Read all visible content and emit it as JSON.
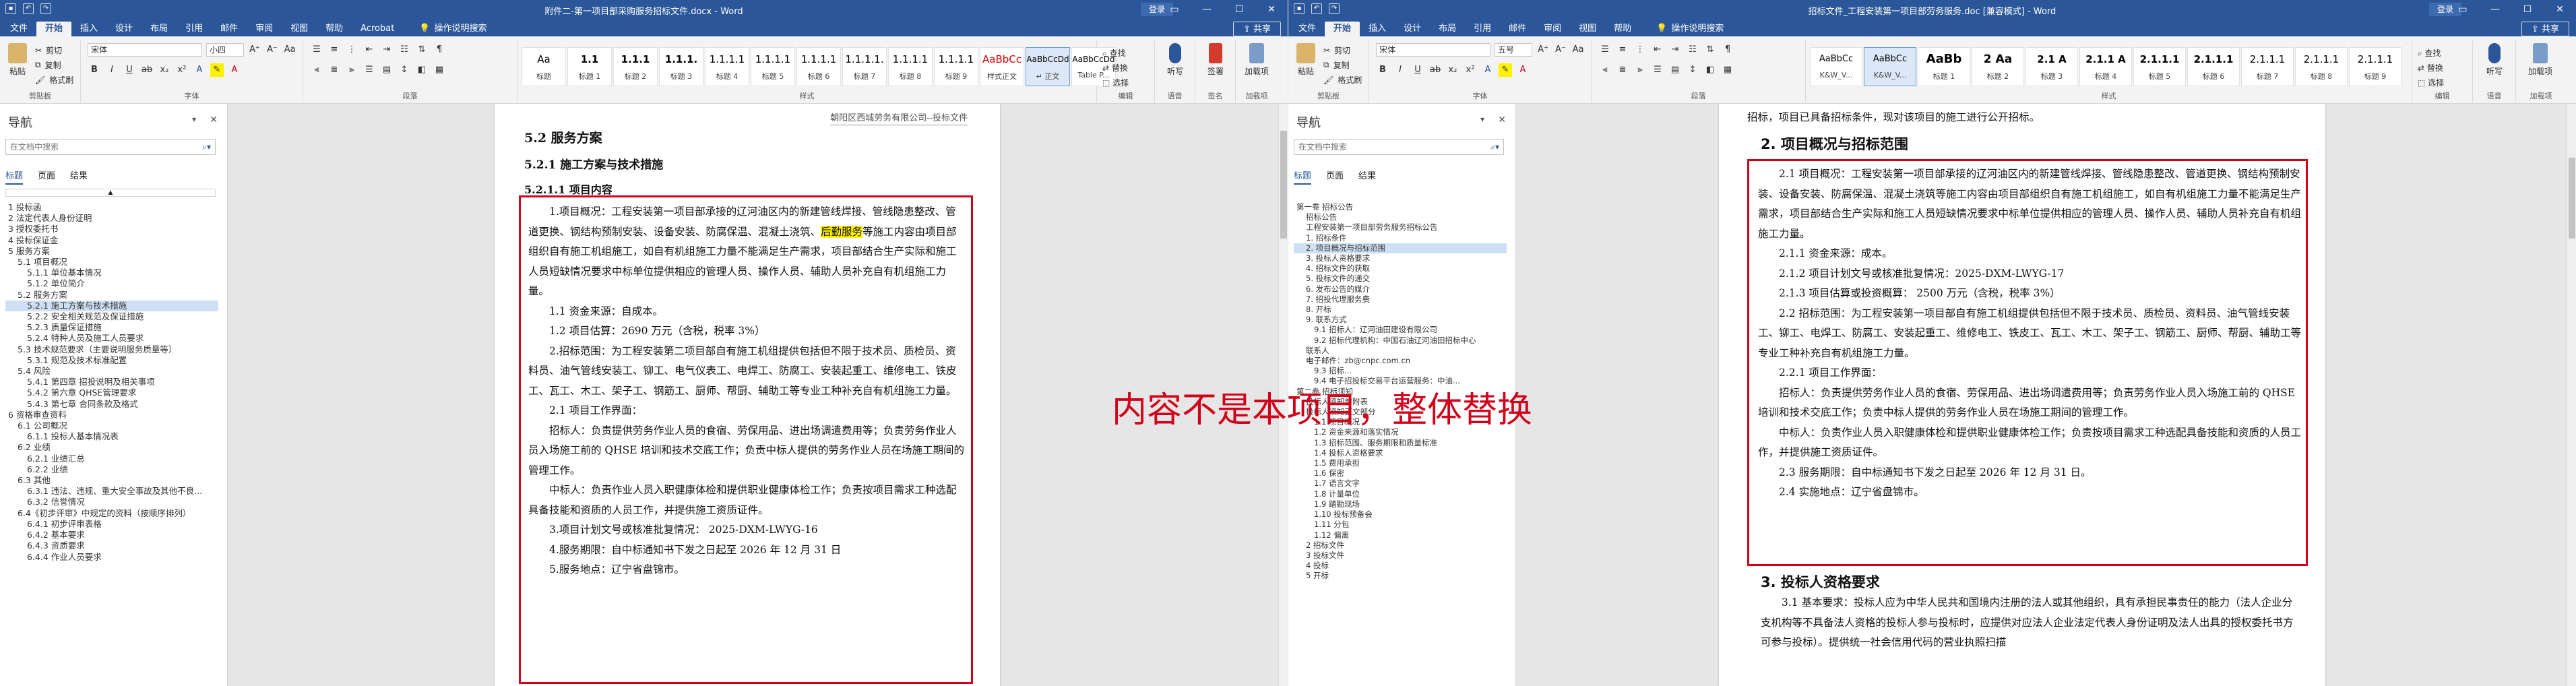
{
  "left": {
    "title": "附件二-第一项目部采购服务招标文件.docx - Word",
    "login": "登录",
    "share": "共享",
    "tabs": [
      "文件",
      "开始",
      "插入",
      "设计",
      "布局",
      "引用",
      "邮件",
      "审阅",
      "视图",
      "帮助",
      "Acrobat"
    ],
    "tell": "操作说明搜索",
    "clipboard": {
      "paste": "粘贴",
      "cut": "剪切",
      "copy": "复制",
      "painter": "格式刷",
      "label": "剪贴板"
    },
    "font": {
      "name": "宋体",
      "size": "小四",
      "label": "字体"
    },
    "paragraph_label": "段落",
    "styles_label": "样式",
    "styles": [
      {
        "sample": "Aa",
        "name": "标题"
      },
      {
        "sample": "1.1",
        "name": "标题 1"
      },
      {
        "sample": "1.1.1",
        "name": "标题 2"
      },
      {
        "sample": "1.1.1.",
        "name": "标题 3"
      },
      {
        "sample": "1.1.1.1",
        "name": "标题 4"
      },
      {
        "sample": "1.1.1.1",
        "name": "标题 5"
      },
      {
        "sample": "1.1.1.1",
        "name": "标题 6"
      },
      {
        "sample": "1.1.1.1.",
        "name": "标题 7"
      },
      {
        "sample": "1.1.1.1",
        "name": "标题 8"
      },
      {
        "sample": "1.1.1.1",
        "name": "标题 9"
      },
      {
        "sample": "AaBbCc",
        "name": "样式正文"
      },
      {
        "sample": "AaBbCcDd",
        "name": "↵ 正文"
      },
      {
        "sample": "AaBbCcDd",
        "name": "Table P..."
      }
    ],
    "editing": {
      "find": "查找",
      "replace": "替换",
      "select": "选择",
      "label": "编辑"
    },
    "voice": {
      "dictate": "听写",
      "label": "语音"
    },
    "sign": {
      "sign": "签署",
      "label": "签名"
    },
    "addins": {
      "addins": "加载项",
      "label": "加载项"
    },
    "nav": {
      "title": "导航",
      "search_placeholder": "在文档中搜索",
      "tabs": [
        "标题",
        "页面",
        "结果"
      ],
      "items": [
        "1 投标函",
        "2 法定代表人身份证明",
        "3 授权委托书",
        "4 投标保证金",
        "5 服务方案",
        "5.1 项目概况",
        "5.1.1 单位基本情况",
        "5.1.2 单位简介",
        "5.2 服务方案",
        "5.2.1 施工方案与技术措施",
        "5.2.2 安全相关规范及保证措施",
        "5.2.3 质量保证措施",
        "5.2.4 特种人员及施工人员要求",
        "5.3 技术规范要求（主要说明服务质量等）",
        "5.3.1 规范及技术标准配置",
        "5.4 风险",
        "5.4.1 第四章 招投说明及相关事项",
        "5.4.2 第六章 QHSE管理要求",
        "5.4.3 第七章 合同条款及格式",
        "6 资格审查资料",
        "6.1 公司概况",
        "6.1.1 投标人基本情况表",
        "6.2 业绩",
        "6.2.1 业绩汇总",
        "6.2.2 业绩",
        "6.3 其他",
        "6.3.1 违法、违规、重大安全事故及其他不良...",
        "6.3.2 信誉情况",
        "6.4《初步评审》中规定的资料（按顺序排列）",
        "6.4.1 初步评审表格",
        "6.4.2 基本要求",
        "6.4.3 资质要求",
        "6.4.4 作业人员要求"
      ]
    },
    "doc": {
      "header": "朝阳区西城劳务有限公司--投标文件",
      "h1": "5.2 服务方案",
      "h2": "5.2.1 施工方案与技术措施",
      "h3": "5.2.1.1 项目内容",
      "p1a": "1.项目概况：工程安装第一项目部承接的辽河油区内的新建管线焊接、管线隐患整改、管道更换、钢结构预制安装、设备安装、防腐保温、混凝土浇筑、",
      "p1hl": "后勤服务",
      "p1b": "等施工内容由项目部组织自有施工机组施工，如自有机组施工力量不能满足生产需求，项目部结合生产实际和施工人员短缺情况要求中标单位提供相应的管理人员、操作人员、辅助人员补充自有机组施工力量。",
      "p2": "1.1 资金来源：自成本。",
      "p3": "1.2 项目估算：2690 万元（含税，税率 3%）",
      "p4": "2.招标范围：为工程安装第二项目部自有施工机组提供包括但不限于技术员、质检员、资料员、油气管线安装工、铆工、电气仪表工、电焊工、防腐工、安装起重工、维修电工、铁皮工、瓦工、木工、架子工、钢筋工、厨师、帮厨、辅助工等专业工种补充自有机组施工力量。",
      "p5": "2.1 项目工作界面：",
      "p6": "招标人：负责提供劳务作业人员的食宿、劳保用品、进出场调遣费用等；负责劳务作业人员入场施工前的 QHSE 培训和技术交底工作；负责中标人提供的劳务作业人员在场施工期间的管理工作。",
      "p7": "中标人：负责作业人员入职健康体检和提供职业健康体检工作；负责按项目需求工种选配具备技能和资质的人员工作，并提供施工资质证件。",
      "p8": "3.项目计划文号或核准批复情况：  2025-DXM-LWYG-16",
      "p9": "4.服务期限：自中标通知书下发之日起至 2026 年 12 月 31 日",
      "p10": "5.服务地点：辽宁省盘锦市。"
    }
  },
  "right": {
    "title": "招标文件_工程安装第一项目部劳务服务.doc [兼容模式] - Word",
    "login": "登录",
    "share": "共享",
    "tabs": [
      "文件",
      "开始",
      "插入",
      "设计",
      "布局",
      "引用",
      "邮件",
      "审阅",
      "视图",
      "帮助"
    ],
    "tell": "操作说明搜索",
    "clipboard": {
      "paste": "粘贴",
      "cut": "剪切",
      "copy": "复制",
      "painter": "格式刷",
      "label": "剪贴板"
    },
    "font": {
      "name": "宋体",
      "size": "五号",
      "label": "字体"
    },
    "paragraph_label": "段落",
    "styles_label": "样式",
    "styles": [
      {
        "sample": "AaBbCc",
        "name": "K&W_V..."
      },
      {
        "sample": "AaBbCc",
        "name": "K&W_V..."
      },
      {
        "sample": "AaBb",
        "name": "标题 1"
      },
      {
        "sample": "2 Aa",
        "name": "标题 2"
      },
      {
        "sample": "2.1 A",
        "name": "标题 3"
      },
      {
        "sample": "2.1.1 A",
        "name": "标题 4"
      },
      {
        "sample": "2.1.1.1",
        "name": "标题 5"
      },
      {
        "sample": "2.1.1.1",
        "name": "标题 6"
      },
      {
        "sample": "2.1.1.1",
        "name": "标题 7"
      },
      {
        "sample": "2.1.1.1",
        "name": "标题 8"
      },
      {
        "sample": "2.1.1.1",
        "name": "标题 9"
      }
    ],
    "editing": {
      "find": "查找",
      "replace": "替换",
      "select": "选择",
      "label": "编辑"
    },
    "voice": {
      "dictate": "听写",
      "label": "语音"
    },
    "addins": {
      "addins": "加载项",
      "label": "加载项"
    },
    "nav": {
      "title": "导航",
      "search_placeholder": "在文档中搜索",
      "tabs": [
        "标题",
        "页面",
        "结果"
      ],
      "items": [
        "第一卷 招标公告",
        "招标公告",
        "工程安装第一项目部劳务服务招标公告",
        "1. 招标条件",
        "2. 项目概况与招标范围",
        "3. 投标人资格要求",
        "4. 招标文件的获取",
        "5. 投标文件的递交",
        "6. 发布公告的媒介",
        "7. 招投代理服务费",
        "8. 开标",
        "9. 联系方式",
        "9.1 招标人：辽河油田建设有限公司",
        "9.2 招标代理机构：中国石油辽河油田招标中心",
        "联系人",
        "电子邮件：zb@cnpc.com.cn",
        "9.3 招标...",
        "9.4 电子招投标交易平台运营服务：中油...",
        "第二卷 招标须知",
        "投标人须知前附表",
        "投标人须知正文部分",
        "1.1 项目概况",
        "1.2 资金来源和落实情况",
        "1.3 招标范围、服务期限和质量标准",
        "1.4 投标人资格要求",
        "1.5 费用承担",
        "1.6 保密",
        "1.7 语言文字",
        "1.8 计量单位",
        "1.9 踏勘现场",
        "1.10 投标预备会",
        "1.11 分包",
        "1.12 偏离",
        "2 招标文件",
        "3 投标文件",
        "4 投标",
        "5 开标"
      ]
    },
    "doc": {
      "top": "招标，项目已具备招标条件，现对该项目的施工进行公开招标。",
      "h2": "2. 项目概况与招标范围",
      "p1": "2.1 项目概况：工程安装第一项目部承接的辽河油区内的新建管线焊接、管线隐患整改、管道更换、钢结构预制安装、设备安装、防腐保温、混凝土浇筑等施工内容由项目部组织自有施工机组施工，如自有机组施工力量不能满足生产需求，项目部结合生产实际和施工人员短缺情况要求中标单位提供相应的管理人员、操作人员、辅助人员补充自有机组施工力量。",
      "p2": "2.1.1 资金来源：成本。",
      "p3": "2.1.2 项目计划文号或核准批复情况：2025-DXM-LWYG-17",
      "p4": "2.1.3 项目估算或投资概算：  2500 万元（含税，税率 3%）",
      "p5": "2.2 招标范围：为工程安装第一项目部自有施工机组提供包括但不限于技术员、质检员、资料员、油气管线安装工、铆工、电焊工、防腐工、安装起重工、维修电工、铁皮工、瓦工、木工、架子工、钢筋工、厨师、帮厨、辅助工等专业工种补充自有机组施工力量。",
      "p6": "2.2.1 项目工作界面：",
      "p7": "招标人：负责提供劳务作业人员的食宿、劳保用品、进出场调遣费用等；负责劳务作业人员入场施工前的 QHSE 培训和技术交底工作；负责中标人提供的劳务作业人员在场施工期间的管理工作。",
      "p8": "中标人：负责作业人员入职健康体检和提供职业健康体检工作；负责按项目需求工种选配具备技能和资质的人员工作，并提供施工资质证件。",
      "p9": "2.3 服务期限：自中标通知书下发之日起至 2026 年 12 月 31 日。",
      "p10": "2.4 实施地点：辽宁省盘锦市。",
      "h3": "3. 投标人资格要求",
      "p11": "3.1 基本要求：投标人应为中华人民共和国境内注册的法人或其他组织，具有承担民事责任的能力（法人企业分支机构等不具备法人资格的投标人参与投标时，应提供对应法人企业法定代表人身份证明及法人出具的授权委托书方可参与投标）。提供统一社会信用代码的营业执照扫描"
    }
  },
  "annotation": {
    "text": "内容不是本项目，整体替换",
    "color": "#d0021b"
  },
  "colors": {
    "word_blue": "#2b579a",
    "highlight": "#fff200",
    "annotation_red": "#d0021b"
  }
}
